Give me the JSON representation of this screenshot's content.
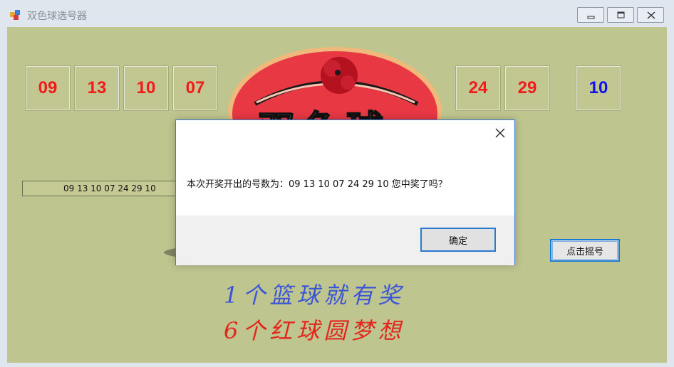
{
  "window": {
    "title": "双色球选号器",
    "controls": [
      "minimize-icon",
      "maximize-icon",
      "close-icon"
    ]
  },
  "balls": {
    "red": [
      "09",
      "13",
      "10",
      "07",
      "24",
      "29"
    ],
    "blue": "10",
    "red_color": "#f21a1a",
    "blue_color": "#1111ee"
  },
  "result_text": "09 13 10 07 24 29 10",
  "draw_button_label": "点击摇号",
  "logo_text": "双色球",
  "slogans": [
    "1个篮球就有奖",
    "6个红球圆梦想"
  ],
  "dialog": {
    "message": "本次开奖开出的号数为：09 13 10 07 24 29 10 您中奖了吗？",
    "ok_label": "确定"
  }
}
